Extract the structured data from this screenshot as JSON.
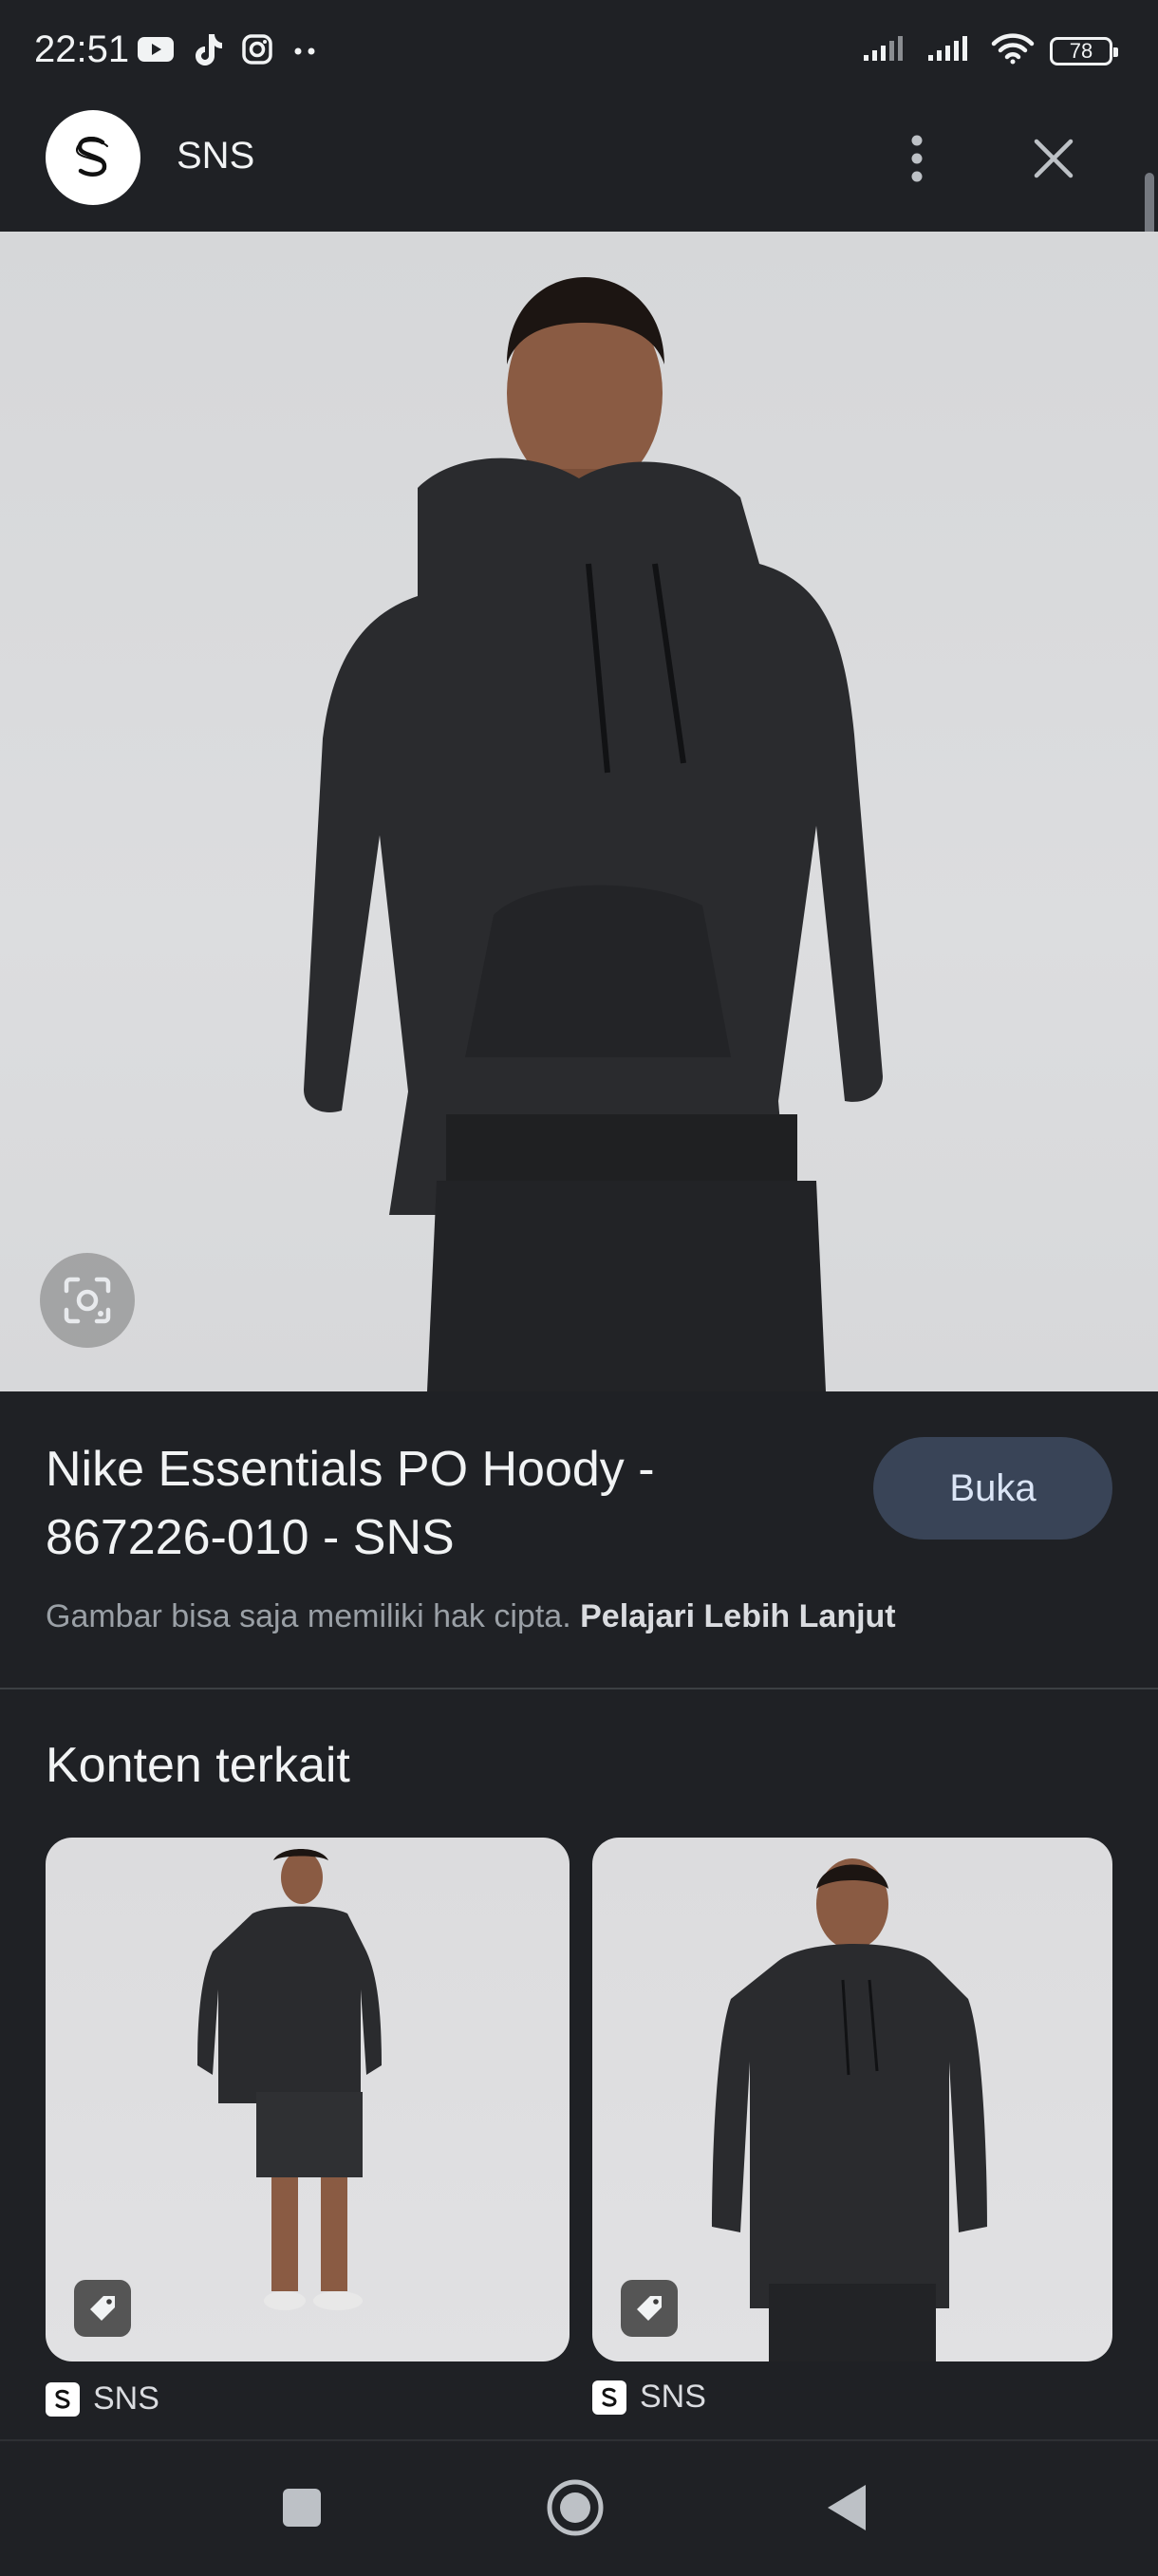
{
  "status_bar": {
    "time": "22:51",
    "battery": "78",
    "app_icons": [
      "youtube-icon",
      "tiktok-icon",
      "instagram-icon",
      "more-dots-icon"
    ]
  },
  "header": {
    "site_name": "SNS"
  },
  "product": {
    "title": "Nike Essentials PO Hoody - 867226-010 - SNS",
    "open_button": "Buka",
    "copyright_text": "Gambar bisa saja memiliki hak cipta.",
    "learn_more": "Pelajari Lebih Lanjut"
  },
  "related": {
    "title": "Konten terkait",
    "cards": [
      {
        "source": "SNS"
      },
      {
        "source": "SNS"
      }
    ]
  },
  "colors": {
    "background": "#1f2125",
    "button": "#394457",
    "button_text": "#dbe5f6"
  }
}
